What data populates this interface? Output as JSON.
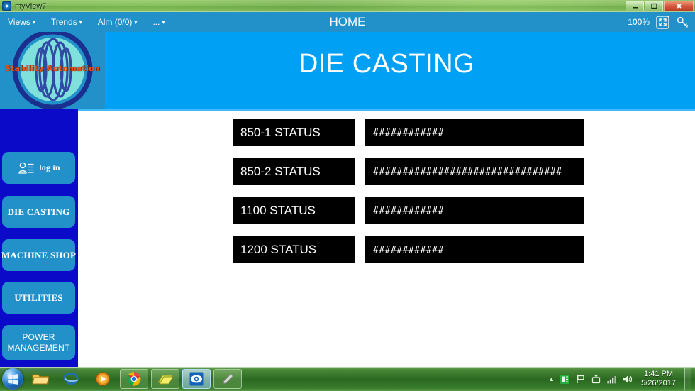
{
  "window": {
    "title": "myView7",
    "icon": "app-eye-icon",
    "buttons": {
      "minimize": "─",
      "maximize": "☐",
      "close": "✕"
    }
  },
  "toolbar": {
    "title": "HOME",
    "menus": [
      {
        "label": "Views",
        "caret": "▾"
      },
      {
        "label": "Trends",
        "caret": "▾"
      },
      {
        "label": "Alm (0/0)",
        "caret": "▾"
      },
      {
        "label": "...",
        "caret": "▾"
      }
    ],
    "zoom_level": "100%",
    "fullscreen_icon": "fullscreen-icon",
    "key_icon": "key-icon",
    "bg_color": "#2291c9"
  },
  "banner": {
    "title": "DIE CASTING",
    "bg_color": "#00a0f5",
    "underline_color": "#3fbcf8"
  },
  "logo": {
    "text": "Stability Automation",
    "text_color": "#e8531f",
    "panel_color": "#2291c9"
  },
  "sidebar": {
    "bg_color": "#0a0ac8",
    "button_color": "#2291c9",
    "items": [
      {
        "label": "log in",
        "icon": "user-profile-icon"
      },
      {
        "label": "DIE CASTING",
        "icon": ""
      },
      {
        "label": "MACHINE SHOP",
        "icon": ""
      },
      {
        "label": "UTILITIES",
        "icon": ""
      },
      {
        "label": "POWER",
        "label2": "MANAGEMENT",
        "icon": ""
      }
    ]
  },
  "main": {
    "status_rows": [
      {
        "label": "850-1 STATUS",
        "value": "############"
      },
      {
        "label": "850-2 STATUS",
        "value": "################################"
      },
      {
        "label": "1100 STATUS",
        "value": "############"
      },
      {
        "label": "1200 STATUS",
        "value": "############"
      }
    ],
    "box_bg_color": "#000000",
    "box_text_color": "#ffffff"
  },
  "taskbar": {
    "start_label": "start-orb",
    "items": [
      {
        "name": "windows-explorer-icon",
        "state": "pinned"
      },
      {
        "name": "internet-explorer-icon",
        "state": "pinned"
      },
      {
        "name": "media-player-icon",
        "state": "pinned"
      },
      {
        "name": "google-chrome-icon",
        "state": "running"
      },
      {
        "name": "folder-notes-icon",
        "state": "running"
      },
      {
        "name": "myview-eye-icon",
        "state": "active"
      },
      {
        "name": "paint-pencil-icon",
        "state": "running"
      }
    ],
    "tray": {
      "overflow_arrow": "▲",
      "icons": [
        "action-center-icon",
        "flag-icon",
        "safely-remove-icon",
        "network-icon",
        "volume-icon"
      ],
      "time": "1:41 PM",
      "date": "5/26/2017"
    }
  }
}
